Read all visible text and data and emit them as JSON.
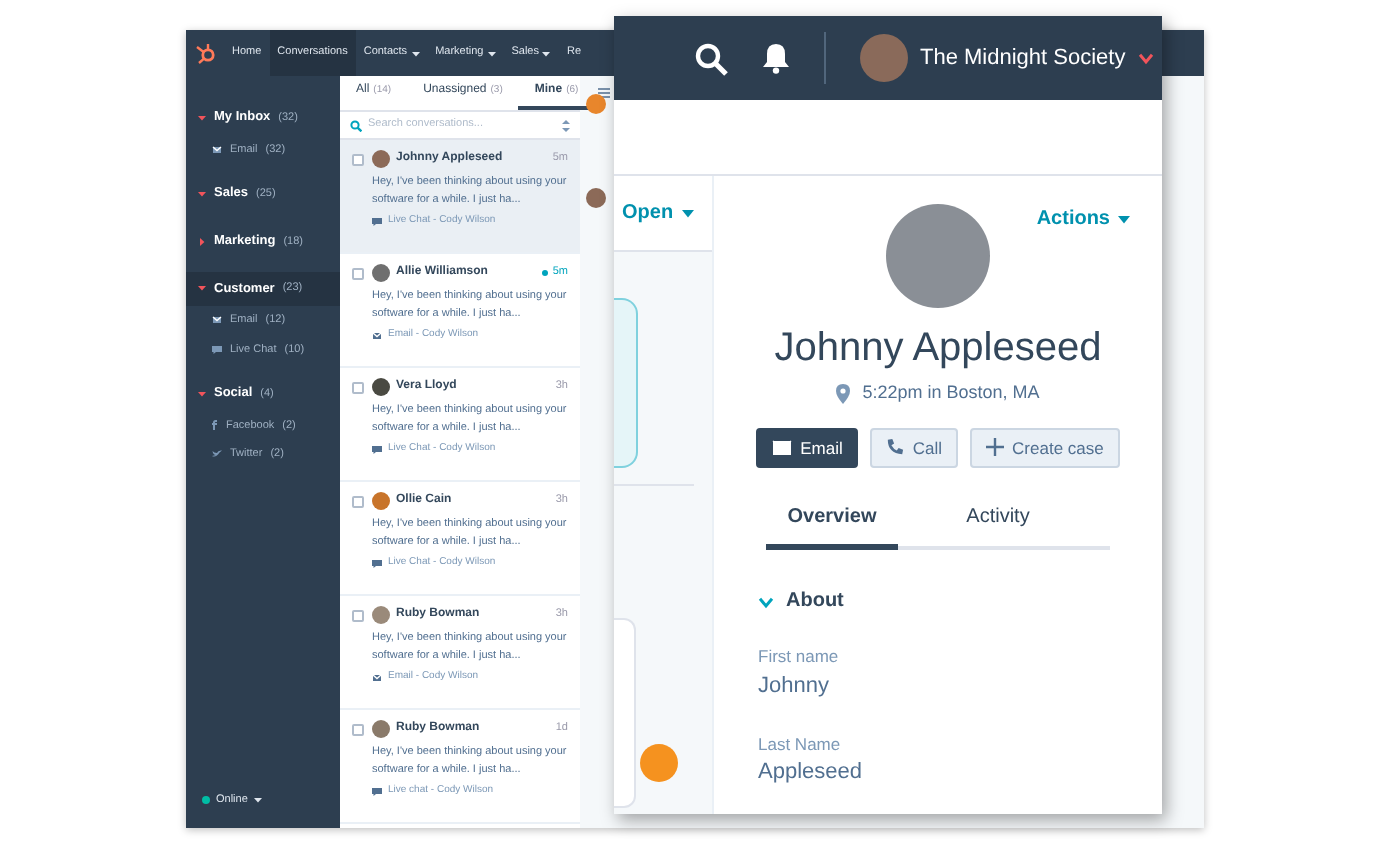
{
  "app_nav": {
    "items": [
      {
        "label": "Home",
        "selected": false,
        "dropdown": false
      },
      {
        "label": "Conversations",
        "selected": true,
        "dropdown": false
      },
      {
        "label": "Contacts",
        "selected": false,
        "dropdown": true
      },
      {
        "label": "Marketing",
        "selected": false,
        "dropdown": true
      },
      {
        "label": "Sales",
        "selected": false,
        "dropdown": true
      },
      {
        "label": "Re",
        "selected": false,
        "dropdown": false
      }
    ]
  },
  "sidebar": {
    "groups": [
      {
        "label": "My Inbox",
        "count": "(32)",
        "expanded": true,
        "selected": false,
        "children": [
          {
            "label": "Email",
            "count": "(32)",
            "kind": "email"
          }
        ]
      },
      {
        "label": "Sales",
        "count": "(25)",
        "expanded": true,
        "selected": false
      },
      {
        "label": "Marketing",
        "count": "(18)",
        "expanded": false,
        "selected": false
      },
      {
        "label": "Customer",
        "count": "(23)",
        "expanded": true,
        "selected": true,
        "children": [
          {
            "label": "Email",
            "count": "(12)",
            "kind": "email"
          },
          {
            "label": "Live Chat",
            "count": "(10)",
            "kind": "chat"
          }
        ]
      },
      {
        "label": "Social",
        "count": "(4)",
        "expanded": true,
        "selected": false,
        "children": [
          {
            "label": "Facebook",
            "count": "(2)",
            "kind": "facebook"
          },
          {
            "label": "Twitter",
            "count": "(2)",
            "kind": "twitter"
          }
        ]
      }
    ],
    "status": {
      "label": "Online",
      "online": true
    }
  },
  "conversation_tabs": [
    {
      "label": "All",
      "count": "(14)",
      "selected": false
    },
    {
      "label": "Unassigned",
      "count": "(3)",
      "selected": false
    },
    {
      "label": "Mine",
      "count": "(6)",
      "selected": true
    }
  ],
  "search": {
    "placeholder": "Search conversations..."
  },
  "conversations": [
    {
      "name": "Johnny Appleseed",
      "time": "5m",
      "unread": false,
      "selected": true,
      "preview": "Hey, I've been thinking about using your software for a while. I just ha...",
      "kind": "chat",
      "channel": "Live Chat - Cody Wilson"
    },
    {
      "name": "Allie Williamson",
      "time": "5m",
      "unread": true,
      "selected": false,
      "preview": "Hey, I've been thinking about using your software for a while. I just ha...",
      "kind": "email",
      "channel": "Email - Cody Wilson"
    },
    {
      "name": "Vera Lloyd",
      "time": "3h",
      "unread": false,
      "selected": false,
      "preview": "Hey, I've been thinking about using your software for a while. I just ha...",
      "kind": "chat",
      "channel": "Live Chat - Cody Wilson"
    },
    {
      "name": "Ollie Cain",
      "time": "3h",
      "unread": false,
      "selected": false,
      "preview": "Hey, I've been thinking about using your software for a while. I just ha...",
      "kind": "chat",
      "channel": "Live Chat - Cody Wilson"
    },
    {
      "name": "Ruby Bowman",
      "time": "3h",
      "unread": false,
      "selected": false,
      "preview": "Hey, I've been thinking about using your software for a while. I just ha...",
      "kind": "email",
      "channel": "Email - Cody Wilson"
    },
    {
      "name": "Ruby Bowman",
      "time": "1d",
      "unread": false,
      "selected": false,
      "preview": "Hey, I've been thinking about using your software for a while. I just ha...",
      "kind": "chat",
      "channel": "Live chat - Cody Wilson"
    }
  ],
  "popup": {
    "account_name": "The Midnight Society",
    "status_button": "Open",
    "contact": {
      "actions_label": "Actions",
      "name": "Johnny Appleseed",
      "location": "5:22pm in Boston, MA",
      "buttons": [
        {
          "label": "Email",
          "kind": "primary"
        },
        {
          "label": "Call",
          "kind": "secondary"
        },
        {
          "label": "Create case",
          "kind": "secondary"
        }
      ],
      "tabs": [
        {
          "label": "Overview",
          "selected": true
        },
        {
          "label": "Activity",
          "selected": false
        }
      ],
      "section": {
        "title": "About",
        "expanded": true,
        "fields": [
          {
            "label": "First name",
            "value": "Johnny"
          },
          {
            "label": "Last Name",
            "value": "Appleseed"
          }
        ]
      }
    }
  }
}
